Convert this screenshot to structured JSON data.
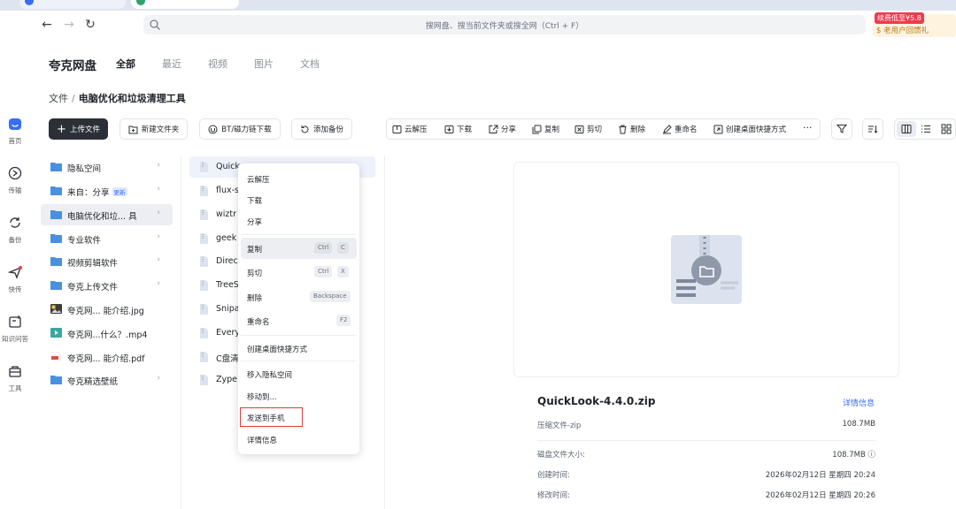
{
  "toolbar": {
    "search_placeholder": "搜网盘、搜当前文件夹或搜全网（Ctrl + F）",
    "promo_badge": "续费低至¥5.8",
    "promo_text": "$ 老用户回馈礼"
  },
  "rail": [
    {
      "label": "首页",
      "icon": "home-icon"
    },
    {
      "label": "传输",
      "icon": "transfer-icon"
    },
    {
      "label": "备份",
      "icon": "backup-icon"
    },
    {
      "label": "快传",
      "icon": "quick-send-icon"
    },
    {
      "label": "知识问答",
      "icon": "qa-icon"
    },
    {
      "label": "工具",
      "icon": "toolbox-icon"
    }
  ],
  "app": {
    "brand": "夸克网盘",
    "tabs": [
      "全部",
      "最近",
      "视频",
      "图片",
      "文档"
    ]
  },
  "breadcrumb": {
    "root": "文件",
    "sep": "/",
    "current": "电脑优化和垃圾清理工具"
  },
  "actions": {
    "upload": "上传文件",
    "new_folder": "新建文件夹",
    "bt": "BT/磁力链下载",
    "backup": "添加备份",
    "ops": [
      "云解压",
      "下载",
      "分享",
      "复制",
      "剪切",
      "删除",
      "重命名",
      "创建桌面快捷方式"
    ],
    "more": "···"
  },
  "tree": [
    {
      "label": "隐私空间",
      "chevron": "›"
    },
    {
      "label": "来自：分享",
      "tag": "更新",
      "chevron": "›"
    },
    {
      "label": "电脑优化和垃... 具",
      "chevron": "›",
      "selected": true
    },
    {
      "label": "专业软件",
      "chevron": "›"
    },
    {
      "label": "视频剪辑软件",
      "chevron": "›"
    },
    {
      "label": "夸克上传文件",
      "chevron": "›"
    },
    {
      "label": "夸克网...  能介绍.jpg"
    },
    {
      "label": "夸克网...什么？.mp4"
    },
    {
      "label": "夸克网...  能介绍.pdf"
    },
    {
      "label": "夸克精选壁纸",
      "chevron": "›"
    }
  ],
  "files": [
    "Quick",
    "flux-s",
    "wiztr",
    "geek",
    "Direc",
    "TreeS",
    "Snipa",
    "Every",
    "C盘清",
    "Zype"
  ],
  "context_menu": {
    "items": [
      {
        "label": "云解压"
      },
      {
        "label": "下载"
      },
      {
        "label": "分享"
      },
      {
        "label": "复制",
        "keys": [
          "Ctrl",
          "C"
        ]
      },
      {
        "label": "剪切",
        "keys": [
          "Ctrl",
          "X"
        ]
      },
      {
        "label": "删除",
        "keys": [
          "Backspace"
        ]
      },
      {
        "label": "重命名",
        "keys": [
          "F2"
        ]
      },
      {
        "label": "创建桌面快捷方式"
      },
      {
        "label": "移入隐私空间"
      },
      {
        "label": "移动到..."
      },
      {
        "label": "发送到手机"
      },
      {
        "label": "详情信息"
      }
    ]
  },
  "preview": {
    "name": "QuickLook-4.4.0.zip",
    "details_link": "详情信息",
    "type": "压缩文件-zip",
    "size": "108.7MB",
    "disk_size_label": "磁盘文件大小:",
    "disk_size": "108.7MB ⓘ",
    "created_label": "创建时间:",
    "created": "2026年02月12日 星期四 20:24",
    "modified_label": "修改时间:",
    "modified": "2026年02月12日 星期四 20:26"
  }
}
